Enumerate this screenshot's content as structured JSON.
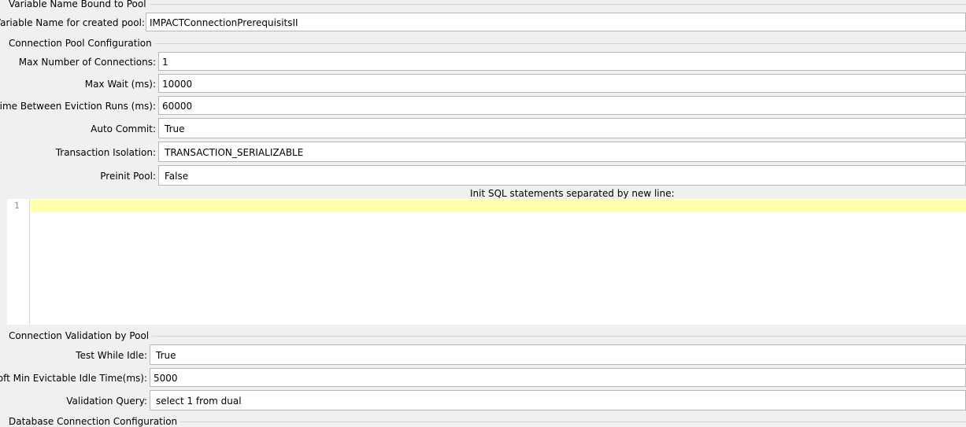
{
  "sections": {
    "variable_binding": "Variable Name Bound to Pool",
    "pool_config": "Connection Pool Configuration",
    "validation": "Connection Validation by Pool",
    "db_config": "Database Connection Configuration"
  },
  "variable_binding": {
    "label": "Variable Name for created pool:",
    "value": "IMPACTConnectionPrerequisitsII"
  },
  "pool_config": {
    "max_connections": {
      "label": "Max Number of Connections:",
      "value": "1"
    },
    "max_wait": {
      "label": "Max Wait (ms):",
      "value": "10000"
    },
    "eviction_runs": {
      "label": "Time Between Eviction Runs (ms):",
      "value": "60000"
    },
    "auto_commit": {
      "label": "Auto Commit:",
      "value": "True"
    },
    "transaction_isolation": {
      "label": "Transaction Isolation:",
      "value": "TRANSACTION_SERIALIZABLE"
    },
    "preinit_pool": {
      "label": "Preinit Pool:",
      "value": "False"
    },
    "init_sql": {
      "caption": "Init SQL statements separated by new line:",
      "line_number": "1",
      "content": ""
    }
  },
  "validation": {
    "test_while_idle": {
      "label": "Test While Idle:",
      "value": "True"
    },
    "soft_min_idle": {
      "label": "Soft Min Evictable Idle Time(ms):",
      "value": "5000"
    },
    "validation_query": {
      "label": "Validation Query:",
      "value": "select 1 from dual"
    }
  }
}
